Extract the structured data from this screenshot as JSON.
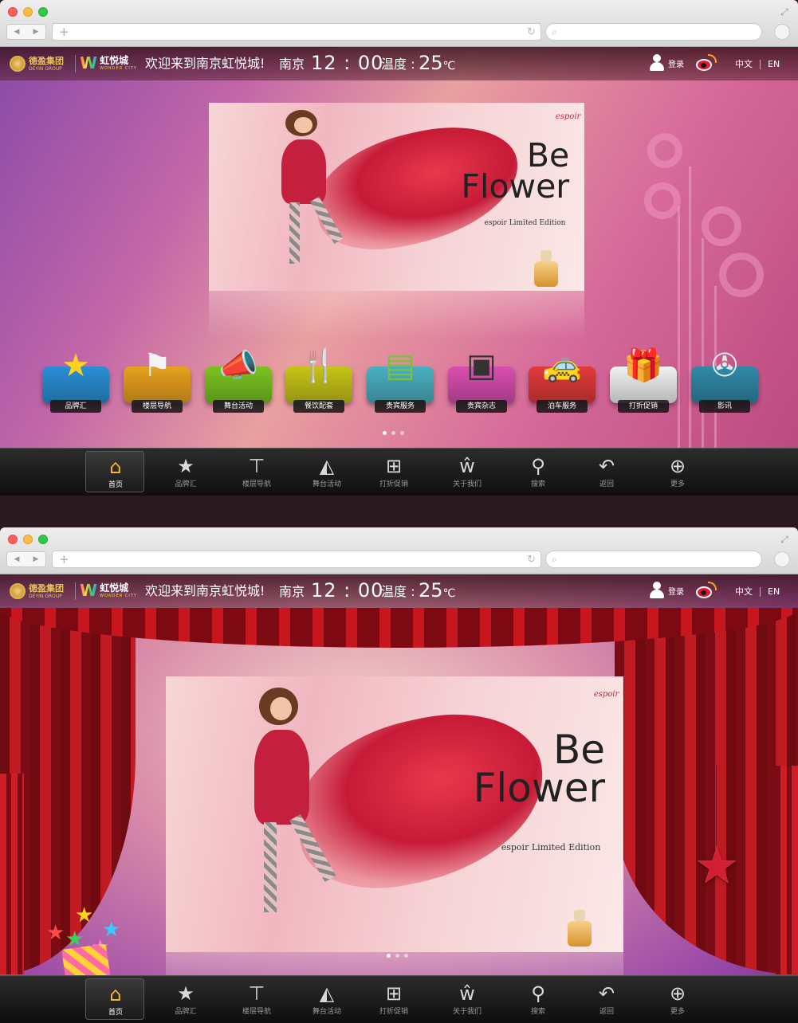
{
  "header": {
    "logo1_cn": "德盈集团",
    "logo1_en": "DEYIN GROUP",
    "logo2_cn": "虹悦城",
    "logo2_sub": "WONDER CITY",
    "welcome": "欢迎来到南京虹悦城!",
    "city": "南京",
    "time": "12 : 00",
    "temp_label": "温度 :",
    "temp_value": "25",
    "temp_unit": "℃",
    "login": "登录",
    "lang_zh": "中文",
    "lang_en": "EN"
  },
  "banner": {
    "brand": "espoir",
    "headline_line1": "Be",
    "headline_line2": "Flower",
    "edition": "espoir Limited Edition"
  },
  "categories": [
    {
      "label": "品牌汇",
      "icon": "star-icon",
      "color": "#2a8fd6"
    },
    {
      "label": "楼层导航",
      "icon": "signpost-icon",
      "color": "#e8a21e"
    },
    {
      "label": "舞台活动",
      "icon": "megaphone-icon",
      "color": "#7bc421"
    },
    {
      "label": "餐饮配套",
      "icon": "dining-icon",
      "color": "#c7c418"
    },
    {
      "label": "贵宾服务",
      "icon": "cards-icon",
      "color": "#4ab0c2"
    },
    {
      "label": "贵宾杂志",
      "icon": "magazine-icon",
      "color": "#d94fb0"
    },
    {
      "label": "泊车服务",
      "icon": "car-icon",
      "color": "#e23a3a"
    },
    {
      "label": "打折促销",
      "icon": "gift-icon",
      "color": "#f2f2f2"
    },
    {
      "label": "影讯",
      "icon": "film-reel-icon",
      "color": "#2f8aa8"
    }
  ],
  "toolbar": [
    {
      "label": "首页",
      "icon": "home-icon",
      "active": true
    },
    {
      "label": "品牌汇",
      "icon": "star-icon"
    },
    {
      "label": "楼层导航",
      "icon": "signpost-icon"
    },
    {
      "label": "舞台活动",
      "icon": "megaphone-icon"
    },
    {
      "label": "打折促销",
      "icon": "gift-icon"
    },
    {
      "label": "关于我们",
      "icon": "about-icon"
    },
    {
      "label": "搜索",
      "icon": "search-icon"
    },
    {
      "label": "返回",
      "icon": "back-icon"
    },
    {
      "label": "更多",
      "icon": "more-icon"
    }
  ],
  "pager": {
    "count": 3,
    "active": 0
  }
}
